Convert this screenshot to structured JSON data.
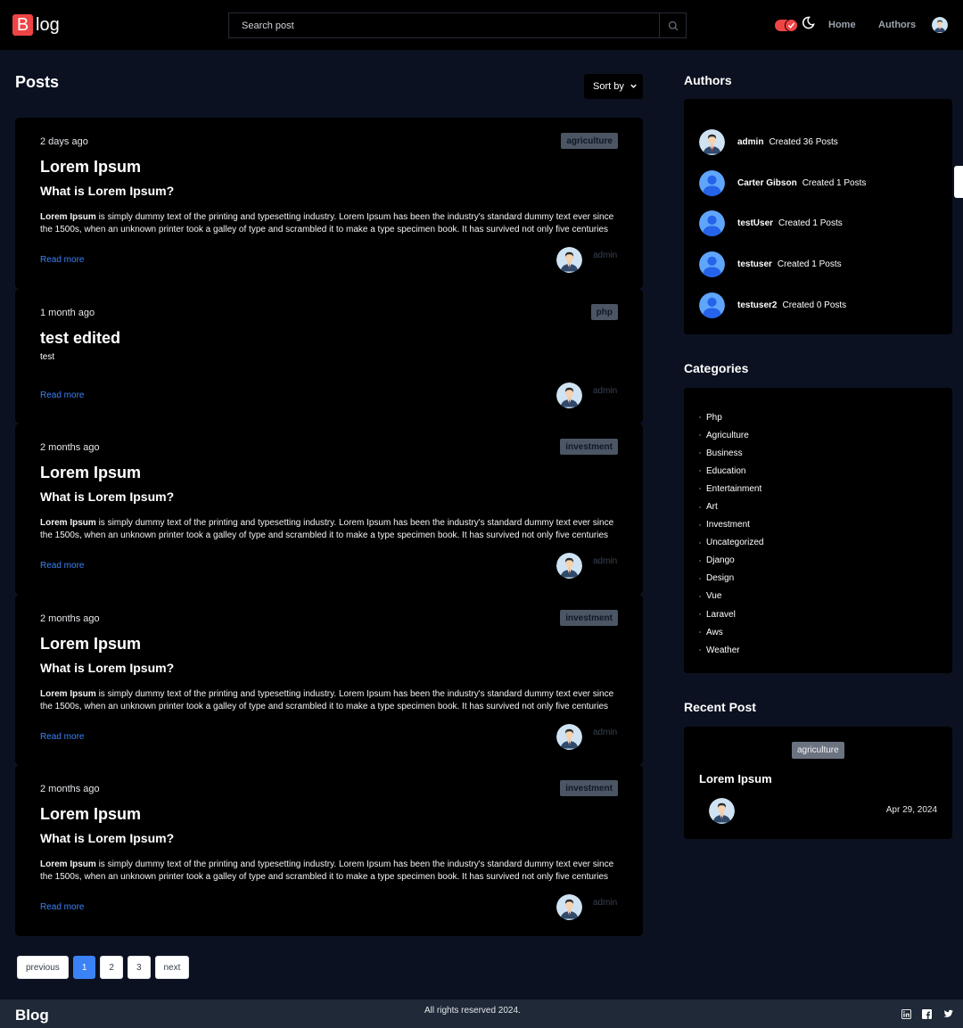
{
  "header": {
    "logo_letter": "B",
    "logo_rest": "log",
    "search_placeholder": "Search post",
    "nav_home": "Home",
    "nav_authors": "Authors"
  },
  "posts": {
    "title": "Posts",
    "sort_label": "Sort by",
    "items": [
      {
        "date": "2 days ago",
        "category": "agriculture",
        "title": "Lorem Ipsum",
        "subtitle": "What is Lorem Ipsum?",
        "excerpt_strong": "Lorem Ipsum",
        "excerpt": " is simply dummy text of the printing and typesetting industry. Lorem Ipsum has been the industry's standard dummy text ever since the 1500s, when an unknown printer took a galley of type and scrambled it to make a type specimen book. It has survived not only five centuries",
        "read_more": "Read more",
        "author": "admin"
      },
      {
        "date": "1 month ago",
        "category": "php",
        "title": "test edited",
        "body": "test",
        "read_more": "Read more",
        "author": "admin"
      },
      {
        "date": "2 months ago",
        "category": "investment",
        "title": "Lorem Ipsum",
        "subtitle": "What is Lorem Ipsum?",
        "excerpt_strong": "Lorem Ipsum",
        "excerpt": " is simply dummy text of the printing and typesetting industry. Lorem Ipsum has been the industry's standard dummy text ever since the 1500s, when an unknown printer took a galley of type and scrambled it to make a type specimen book. It has survived not only five centuries",
        "read_more": "Read more",
        "author": "admin"
      },
      {
        "date": "2 months ago",
        "category": "investment",
        "title": "Lorem Ipsum",
        "subtitle": "What is Lorem Ipsum?",
        "excerpt_strong": "Lorem Ipsum",
        "excerpt": " is simply dummy text of the printing and typesetting industry. Lorem Ipsum has been the industry's standard dummy text ever since the 1500s, when an unknown printer took a galley of type and scrambled it to make a type specimen book. It has survived not only five centuries",
        "read_more": "Read more",
        "author": "admin"
      },
      {
        "date": "2 months ago",
        "category": "investment",
        "title": "Lorem Ipsum",
        "subtitle": "What is Lorem Ipsum?",
        "excerpt_strong": "Lorem Ipsum",
        "excerpt": " is simply dummy text of the printing and typesetting industry. Lorem Ipsum has been the industry's standard dummy text ever since the 1500s, when an unknown printer took a galley of type and scrambled it to make a type specimen book. It has survived not only five centuries",
        "read_more": "Read more",
        "author": "admin"
      }
    ]
  },
  "pagination": {
    "previous": "previous",
    "pages": [
      "1",
      "2",
      "3"
    ],
    "next": "next"
  },
  "authors": {
    "title": "Authors",
    "items": [
      {
        "name": "admin",
        "info": "Created 36 Posts"
      },
      {
        "name": "Carter Gibson",
        "info": "Created 1 Posts"
      },
      {
        "name": "testUser",
        "info": "Created 1 Posts"
      },
      {
        "name": "testuser",
        "info": "Created 1 Posts"
      },
      {
        "name": "testuser2",
        "info": "Created 0 Posts"
      }
    ]
  },
  "categories": {
    "title": "Categories",
    "items": [
      "Php",
      "Agriculture",
      "Business",
      "Education",
      "Entertainment",
      "Art",
      "Investment",
      "Uncategorized",
      "Django",
      "Design",
      "Vue",
      "Laravel",
      "Aws",
      "Weather"
    ]
  },
  "recent": {
    "title": "Recent Post",
    "category": "agriculture",
    "post_title": "Lorem Ipsum",
    "date": "Apr 29, 2024"
  },
  "footer": {
    "brand": "Blog",
    "copyright": "All rights reserved 2024."
  },
  "colors": {
    "accent": "#ef4444",
    "link": "#3b82f6",
    "background": "#0b1120",
    "card": "#000000"
  }
}
